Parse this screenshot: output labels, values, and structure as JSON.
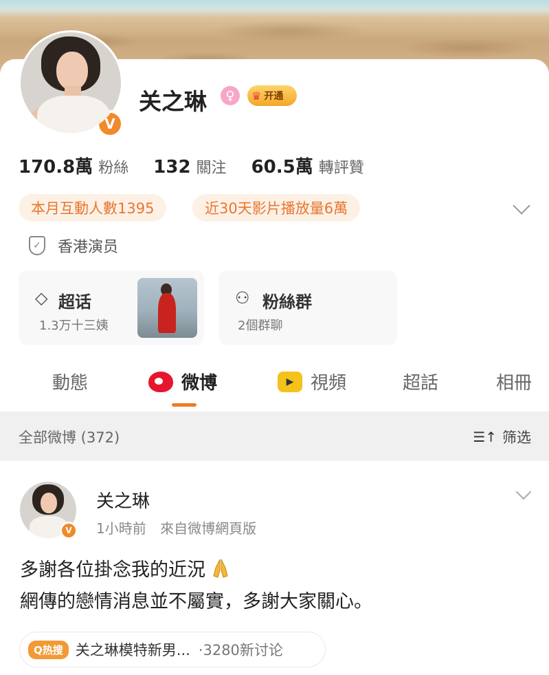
{
  "profile": {
    "name": "关之琳",
    "vip_label": "开通",
    "verified_badge": "V"
  },
  "stats": [
    {
      "value": "170.8萬",
      "label": "粉絲"
    },
    {
      "value": "132",
      "label": "關注"
    },
    {
      "value": "60.5萬",
      "label": "轉評贊"
    }
  ],
  "pills": {
    "interaction": "本月互動人數1395",
    "video_plays": "近30天影片播放量6萬"
  },
  "certification": "香港演员",
  "tiles": {
    "supertopic": {
      "title": "超话",
      "subtitle": "1.3万十三姨"
    },
    "fans_group": {
      "title": "粉絲群",
      "subtitle": "2個群聊"
    }
  },
  "tabs": [
    "動態",
    "微博",
    "視頻",
    "超話",
    "相冊"
  ],
  "filter": {
    "all_label": "全部微博 (372)",
    "filter_label": "筛选"
  },
  "post": {
    "author": "关之琳",
    "time": "1小時前",
    "source": "來自微博網頁版",
    "line1": "多謝各位掛念我的近況",
    "line2": "網傳的戀情消息並不屬實，多謝大家關心。",
    "hot_tag": "Q热搜",
    "hot_text": "关之琳模特新男...",
    "hot_count": "·3280新讨论"
  },
  "icons": {
    "gender": "female-icon",
    "vip": "crown-icon",
    "cert": "shield-icon",
    "supertopic": "diamond-icon",
    "fans": "people-icon",
    "weibo": "weibo-logo-icon",
    "video": "video-icon",
    "filter": "sort-icon",
    "emoji": "praying-hands-icon"
  },
  "colors": {
    "accent": "#f07b22",
    "pill_bg": "#fdf1e6",
    "pill_text": "#e8762f",
    "verified": "#f08a2a"
  }
}
